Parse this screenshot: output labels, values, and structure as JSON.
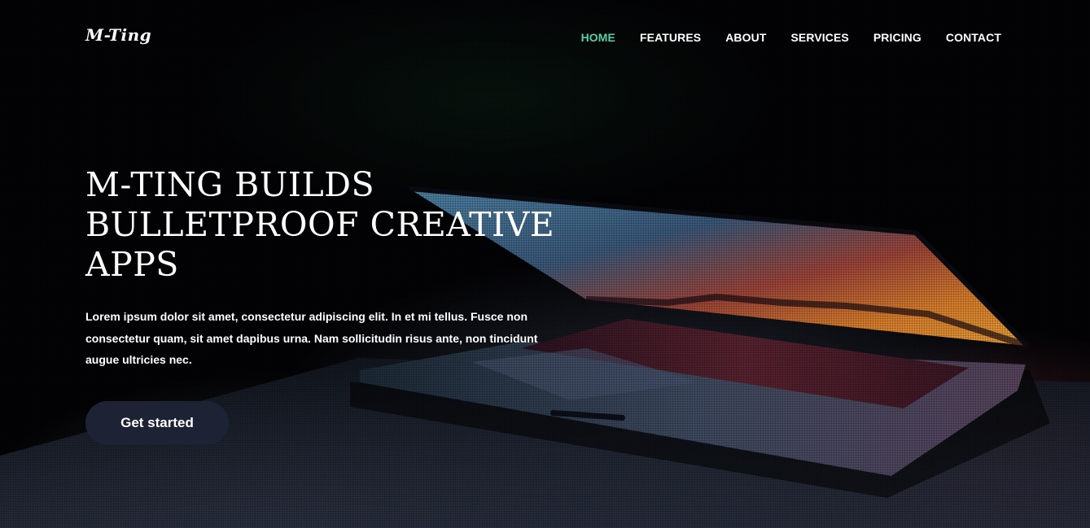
{
  "brand": {
    "logo_text": "M-Ting"
  },
  "nav": {
    "items": [
      {
        "label": "HOME",
        "active": true
      },
      {
        "label": "FEATURES",
        "active": false
      },
      {
        "label": "ABOUT",
        "active": false
      },
      {
        "label": "SERVICES",
        "active": false
      },
      {
        "label": "PRICING",
        "active": false
      },
      {
        "label": "CONTACT",
        "active": false
      }
    ]
  },
  "hero": {
    "title": "M-Ting builds bulletproof creative apps",
    "description": "Lorem ipsum dolor sit amet, consectetur adipiscing elit. In et mi tellus. Fusce non consectetur quam, sit amet dapibus urna. Nam sollicitudin risus ante, non tincidunt augue ultricies nec.",
    "cta_label": "Get started",
    "background_image": "laptop-image"
  },
  "colors": {
    "accent": "#57cfa6",
    "button_bg": "#1e2235",
    "text": "#ffffff",
    "background": "#030305"
  }
}
